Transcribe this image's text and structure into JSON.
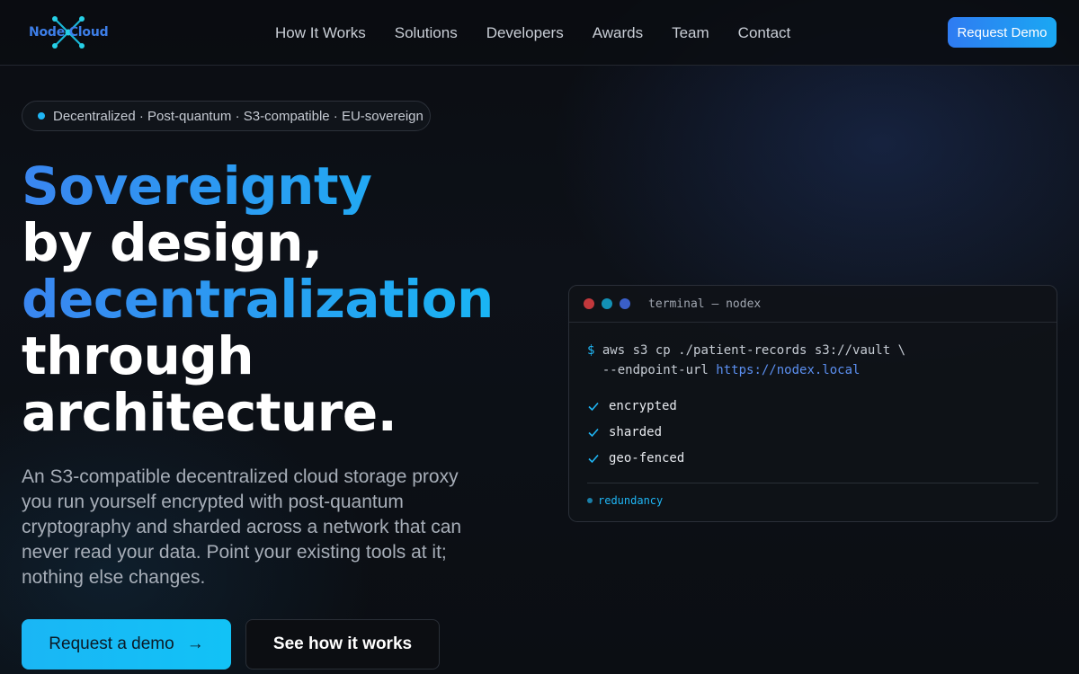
{
  "nav": {
    "logo_text": "Node Cloud",
    "links": [
      "How It Works",
      "Solutions",
      "Developers",
      "Awards",
      "Team",
      "Contact"
    ],
    "demo_button": "Request Demo"
  },
  "hero": {
    "pill_text": "Decentralized · Post-quantum · S3-compatible · EU-sovereign",
    "headline": [
      "Sovereignty",
      "by design,",
      "decentralization",
      "through",
      "architecture."
    ],
    "subtext": "An S3-compatible decentralized cloud storage proxy you run yourself encrypted with post-quantum cryptography and sharded across a network that can never read your data. Point your existing tools at it; nothing else changes.",
    "cta_primary": "Request a demo",
    "cta_primary_arrow": "→",
    "cta_secondary": "See how it works"
  },
  "terminal": {
    "title": "terminal — nodex",
    "prompt": "$",
    "command_line1": "aws s3 cp ./patient-records s3://vault \\",
    "command_line2_prefix": "  --endpoint-url",
    "command_url": "https://nodex.local",
    "checks": [
      "encrypted",
      "sharded",
      "geo-fenced"
    ],
    "footer_label": "redundancy",
    "dot_colors": [
      "#c2383c",
      "#1391b6",
      "#3a5fc9"
    ]
  },
  "colors": {
    "accent_blue": "#2f7bf2",
    "accent_cyan": "#1ab6f5"
  }
}
